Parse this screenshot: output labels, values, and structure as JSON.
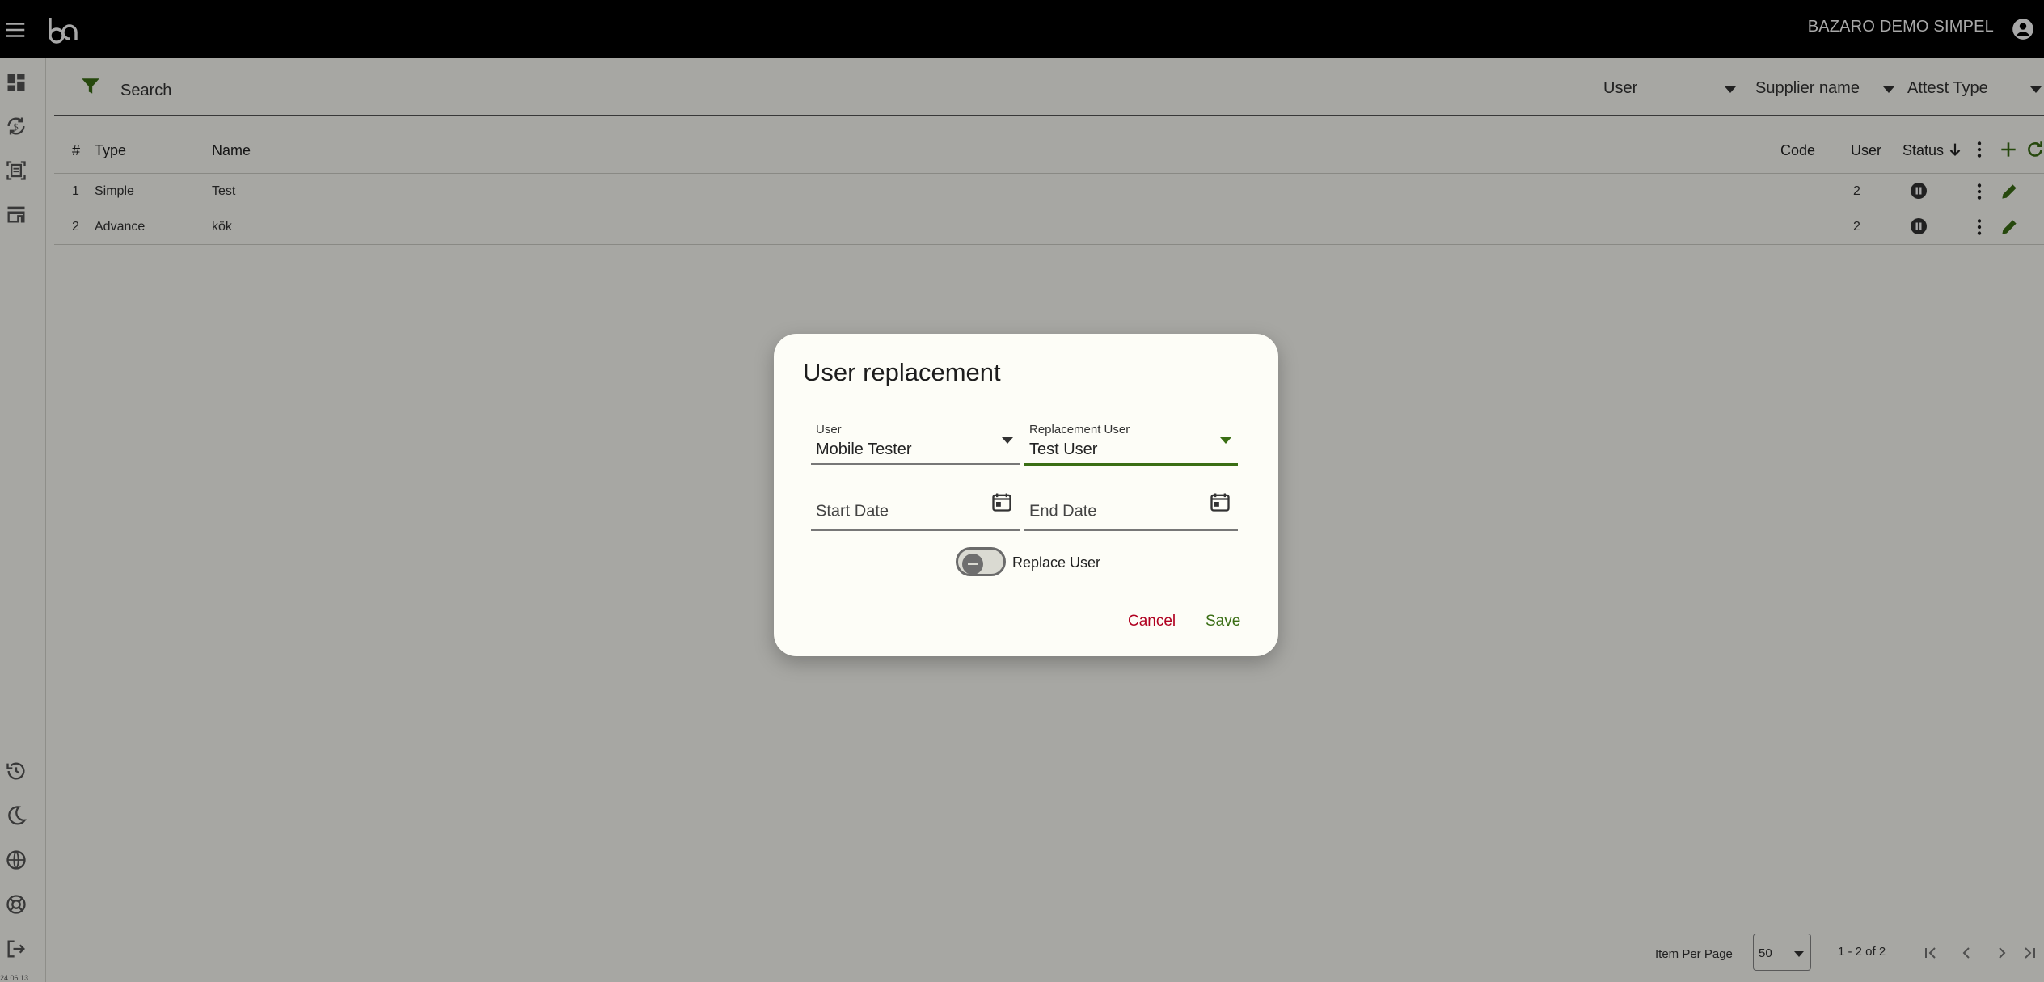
{
  "app": {
    "brand": "BAZARO DEMO SIMPEL",
    "version": "24.06.13"
  },
  "colors": {
    "accent_green": "#3a6e14",
    "cancel_red": "#b00020",
    "topbar": "#000000"
  },
  "filterbar": {
    "search_placeholder": "Search",
    "selects": [
      "User",
      "Supplier name",
      "Attest Type"
    ]
  },
  "table": {
    "headers": {
      "num": "#",
      "type": "Type",
      "name": "Name",
      "code": "Code",
      "user": "User",
      "status": "Status"
    },
    "rows": [
      {
        "num": "1",
        "type": "Simple",
        "name": "Test",
        "code": "",
        "user": "2"
      },
      {
        "num": "2",
        "type": "Advance",
        "name": "kök",
        "code": "",
        "user": "2"
      }
    ]
  },
  "pager": {
    "items_per_page_label": "Item Per Page",
    "per_page_value": "50",
    "range": "1 - 2 of 2"
  },
  "dialog": {
    "title": "User replacement",
    "user_label": "User",
    "user_value": "Mobile Tester",
    "replacement_label": "Replacement User",
    "replacement_value": "Test User",
    "start_placeholder": "Start Date",
    "end_placeholder": "End Date",
    "toggle_label": "Replace User",
    "cancel_label": "Cancel",
    "save_label": "Save"
  }
}
